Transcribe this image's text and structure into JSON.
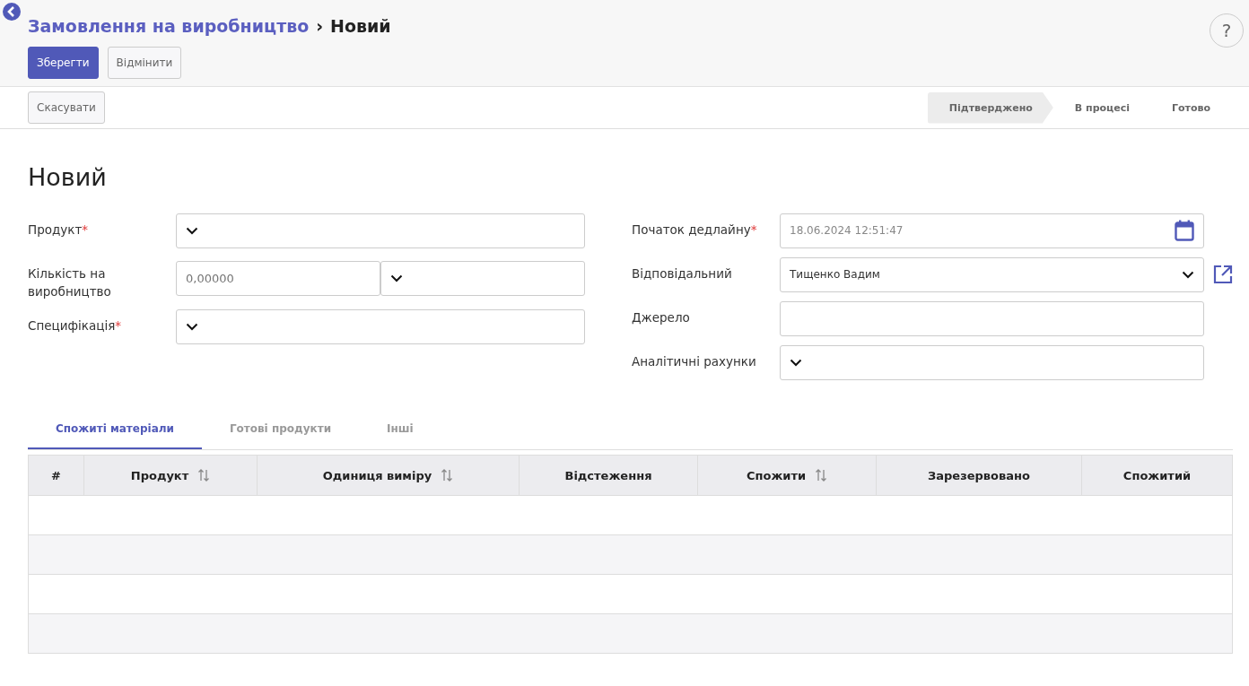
{
  "breadcrumb": {
    "parent": "Замовлення на виробництво",
    "separator": "›",
    "current": "Новий"
  },
  "actions": [
    {
      "label": "Зберегти",
      "kind": "primary"
    },
    {
      "label": "Відмінити",
      "kind": "secondary"
    }
  ],
  "status_bar": {
    "buttons": [
      {
        "label": "Скасувати"
      }
    ],
    "stages": [
      {
        "label": "Підтверджено",
        "selected": true
      },
      {
        "label": "В процесі",
        "selected": false
      },
      {
        "label": "Готово",
        "selected": false
      }
    ]
  },
  "help": "?",
  "record_title": "Новий",
  "left_fields": [
    {
      "label": "Продукт",
      "required_mark": "*",
      "kind": "select"
    },
    {
      "label": "Кількість на виробництво",
      "kind": "quantity",
      "placeholder": "0,00000"
    },
    {
      "label": "Специфікація",
      "required_mark": "*",
      "kind": "select"
    }
  ],
  "right_fields": [
    {
      "label": "Початок дедлайну",
      "required_mark": "*",
      "kind": "date",
      "value": "18.06.2024 12:51:47"
    },
    {
      "label": "Відповідальний",
      "kind": "select",
      "value": "Тищенко Вадим",
      "link": true
    },
    {
      "label": "Джерело",
      "kind": "text"
    },
    {
      "label": "Аналітичні рахунки",
      "kind": "select"
    }
  ],
  "tabs": [
    {
      "label": "Спожиті матеріали",
      "selected": true
    },
    {
      "label": "Готові продукти",
      "selected": false
    },
    {
      "label": "Інші",
      "selected": false
    }
  ],
  "table": {
    "columns": [
      {
        "label": "#",
        "sortable": false
      },
      {
        "label": "Продукт",
        "sortable": true
      },
      {
        "label": "Одиниця виміру",
        "sortable": true
      },
      {
        "label": "Відстеження",
        "sortable": false
      },
      {
        "label": "Спожити",
        "sortable": true
      },
      {
        "label": "Зарезервовано",
        "sortable": false
      },
      {
        "label": "Спожитий",
        "sortable": false
      }
    ]
  }
}
